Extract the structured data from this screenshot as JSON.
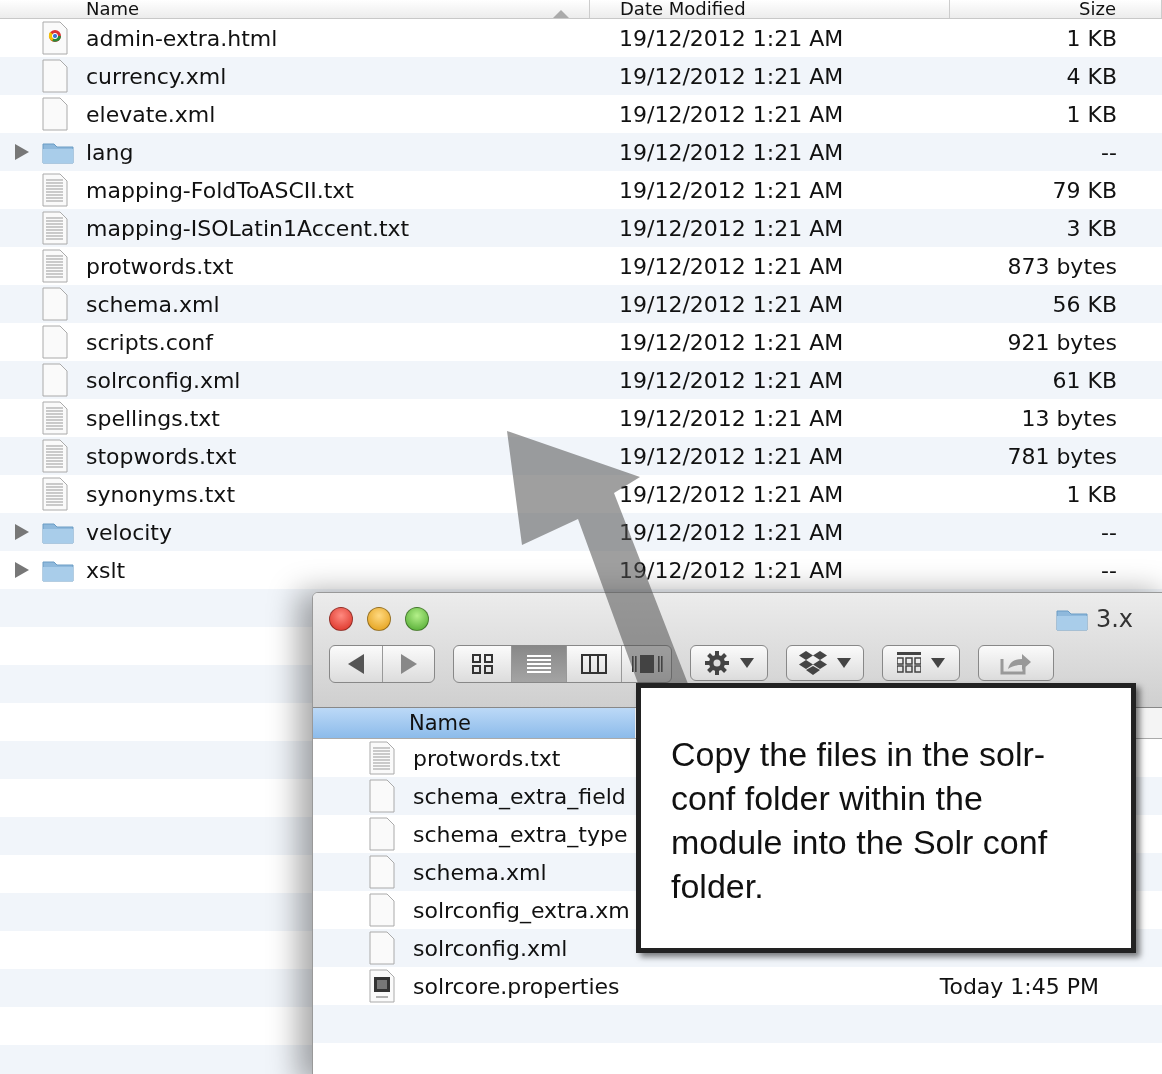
{
  "list": {
    "columns": [
      {
        "label": "Name",
        "sorted": true
      },
      {
        "label": "Date Modified",
        "sorted": false
      },
      {
        "label": "Size",
        "sorted": false
      }
    ],
    "rows": [
      {
        "kind": "web",
        "name": "admin-extra.html",
        "date": "19/12/2012 1:21 AM",
        "size": "1 KB"
      },
      {
        "kind": "blank",
        "name": "currency.xml",
        "date": "19/12/2012 1:21 AM",
        "size": "4 KB"
      },
      {
        "kind": "blank",
        "name": "elevate.xml",
        "date": "19/12/2012 1:21 AM",
        "size": "1 KB"
      },
      {
        "kind": "folder",
        "expanded": false,
        "name": "lang",
        "date": "19/12/2012 1:21 AM",
        "size": "--"
      },
      {
        "kind": "text",
        "name": "mapping-FoldToASCII.txt",
        "date": "19/12/2012 1:21 AM",
        "size": "79 KB"
      },
      {
        "kind": "text",
        "name": "mapping-ISOLatin1Accent.txt",
        "date": "19/12/2012 1:21 AM",
        "size": "3 KB"
      },
      {
        "kind": "text",
        "name": "protwords.txt",
        "date": "19/12/2012 1:21 AM",
        "size": "873 bytes"
      },
      {
        "kind": "blank",
        "name": "schema.xml",
        "date": "19/12/2012 1:21 AM",
        "size": "56 KB"
      },
      {
        "kind": "blank",
        "name": "scripts.conf",
        "date": "19/12/2012 1:21 AM",
        "size": "921 bytes"
      },
      {
        "kind": "blank",
        "name": "solrconfig.xml",
        "date": "19/12/2012 1:21 AM",
        "size": "61 KB"
      },
      {
        "kind": "text",
        "name": "spellings.txt",
        "date": "19/12/2012 1:21 AM",
        "size": "13 bytes"
      },
      {
        "kind": "text",
        "name": "stopwords.txt",
        "date": "19/12/2012 1:21 AM",
        "size": "781 bytes"
      },
      {
        "kind": "text",
        "name": "synonyms.txt",
        "date": "19/12/2012 1:21 AM",
        "size": "1 KB"
      },
      {
        "kind": "folder",
        "expanded": false,
        "name": "velocity",
        "date": "19/12/2012 1:21 AM",
        "size": "--"
      },
      {
        "kind": "folder",
        "expanded": false,
        "name": "xslt",
        "date": "19/12/2012 1:21 AM",
        "size": "--"
      }
    ]
  },
  "window": {
    "title": "3.x",
    "views": [
      {
        "kind": "icons",
        "selected": false
      },
      {
        "kind": "list",
        "selected": true
      },
      {
        "kind": "columns",
        "selected": false
      },
      {
        "kind": "coverflow",
        "selected": false
      }
    ],
    "tools": [
      {
        "kind": "action",
        "menu": true
      },
      {
        "kind": "dropbox",
        "menu": true
      },
      {
        "kind": "arrange",
        "menu": true
      },
      {
        "kind": "share",
        "menu": false
      }
    ],
    "header": {
      "label": "Name",
      "selected": true
    },
    "rows": [
      {
        "kind": "text",
        "name": "protwords.txt"
      },
      {
        "kind": "blank",
        "name": "schema_extra_field"
      },
      {
        "kind": "blank",
        "name": "schema_extra_type"
      },
      {
        "kind": "blank",
        "name": "schema.xml"
      },
      {
        "kind": "blank",
        "name": "solrconfig_extra.xm"
      },
      {
        "kind": "blank",
        "name": "solrconfig.xml"
      },
      {
        "kind": "java",
        "name": "solrcore.properties",
        "date": "Today 1:45 PM"
      }
    ]
  },
  "callout": {
    "text": "Copy the files in the solr-conf folder within the module into the Solr conf folder."
  }
}
